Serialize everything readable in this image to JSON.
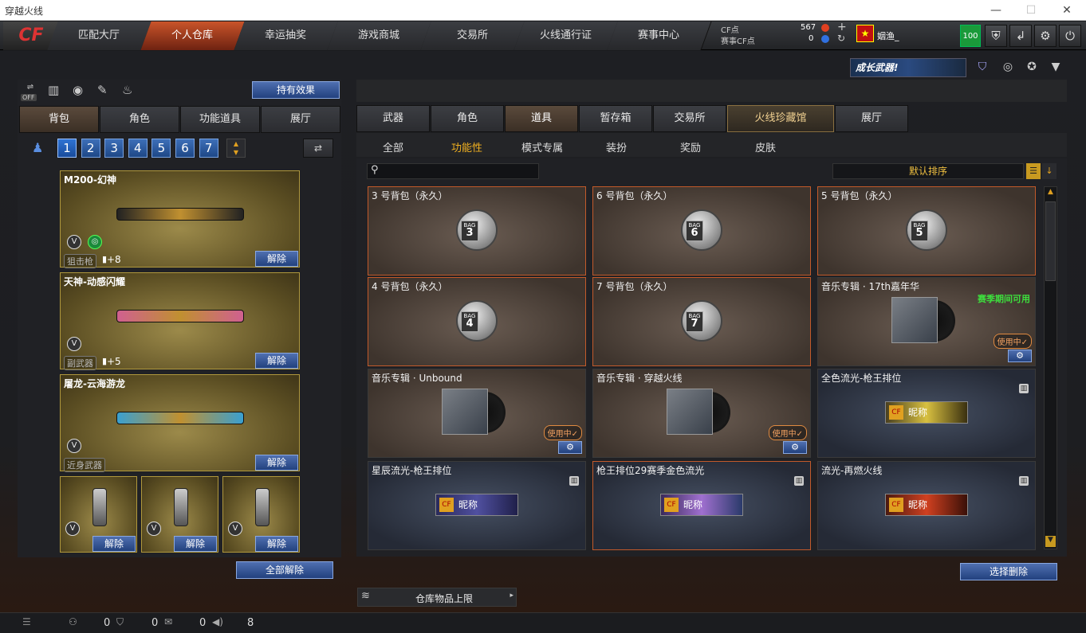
{
  "window": {
    "title": "穿越火线"
  },
  "nav": {
    "tabs": [
      "匹配大厅",
      "个人仓库",
      "幸运抽奖",
      "游戏商城",
      "交易所",
      "火线通行证",
      "赛事中心"
    ],
    "active": 1,
    "cf_label": "CF点",
    "cf_value": "567",
    "event_label": "赛事CF点",
    "event_value": "0",
    "player_name": "姻渔_",
    "level": "100"
  },
  "growth_banner": "成长武器!",
  "left": {
    "holding_effect_btn": "持有效果",
    "off_label": "OFF",
    "tabs": [
      "背包",
      "角色",
      "功能道具",
      "展厅"
    ],
    "active_tab": 0,
    "bag_numbers": [
      "1",
      "2",
      "3",
      "4",
      "5",
      "6",
      "7"
    ],
    "active_bag": 0,
    "weapons": [
      {
        "name": "M200-幻神",
        "type": "狙击枪",
        "ammo": "+8",
        "remove": "解除"
      },
      {
        "name": "天神-动感闪耀",
        "type": "副武器",
        "ammo": "+5",
        "remove": "解除"
      },
      {
        "name": "屠龙-云海游龙",
        "type": "近身武器",
        "ammo": "",
        "remove": "解除"
      }
    ],
    "grenades": [
      {
        "remove": "解除"
      },
      {
        "remove": "解除"
      },
      {
        "remove": "解除"
      }
    ],
    "remove_all": "全部解除"
  },
  "right": {
    "tabs": [
      "武器",
      "角色",
      "道具",
      "暂存箱",
      "交易所",
      "火线珍藏馆",
      "展厅"
    ],
    "active_tab": 2,
    "subtabs": [
      "全部",
      "功能性",
      "模式专属",
      "装扮",
      "奖励",
      "皮肤"
    ],
    "active_subtab": 1,
    "search_placeholder": "",
    "sort_label": "默认排序",
    "items": [
      {
        "title": "3 号背包（永久）",
        "kind": "bag",
        "num": "3",
        "bag_text": "BAG"
      },
      {
        "title": "6 号背包（永久）",
        "kind": "bag",
        "num": "6",
        "bag_text": "BAG"
      },
      {
        "title": "5 号背包（永久）",
        "kind": "bag",
        "num": "5",
        "bag_text": "BAG"
      },
      {
        "title": "4 号背包（永久）",
        "kind": "bag",
        "num": "4",
        "bag_text": "BAG"
      },
      {
        "title": "7 号背包（永久）",
        "kind": "bag",
        "num": "7",
        "bag_text": "BAG"
      },
      {
        "title": "音乐专辑 · 17th嘉年华",
        "kind": "music",
        "season": "赛季期间可用",
        "in_use": "使用中✓"
      },
      {
        "title": "音乐专辑 · Unbound",
        "kind": "music",
        "in_use": "使用中✓"
      },
      {
        "title": "音乐专辑 · 穿越火线",
        "kind": "music",
        "in_use": "使用中✓"
      },
      {
        "title": "全色流光-枪王排位",
        "kind": "rank",
        "nick": "昵称"
      },
      {
        "title": "星辰流光-枪王排位",
        "kind": "rank",
        "nick": "昵称"
      },
      {
        "title": "枪王排位29赛季金色流光",
        "kind": "rank",
        "nick": "昵称"
      },
      {
        "title": "流光-再燃火线",
        "kind": "rank",
        "nick": "昵称"
      }
    ],
    "select_delete": "选择删除",
    "storage_limit": "仓库物品上限"
  },
  "status": {
    "a": "0",
    "b": "0",
    "c": "0",
    "d": "8"
  },
  "colors": {
    "accent": "#c9542a",
    "gold": "#f0b020",
    "blue": "#2f73d4"
  }
}
